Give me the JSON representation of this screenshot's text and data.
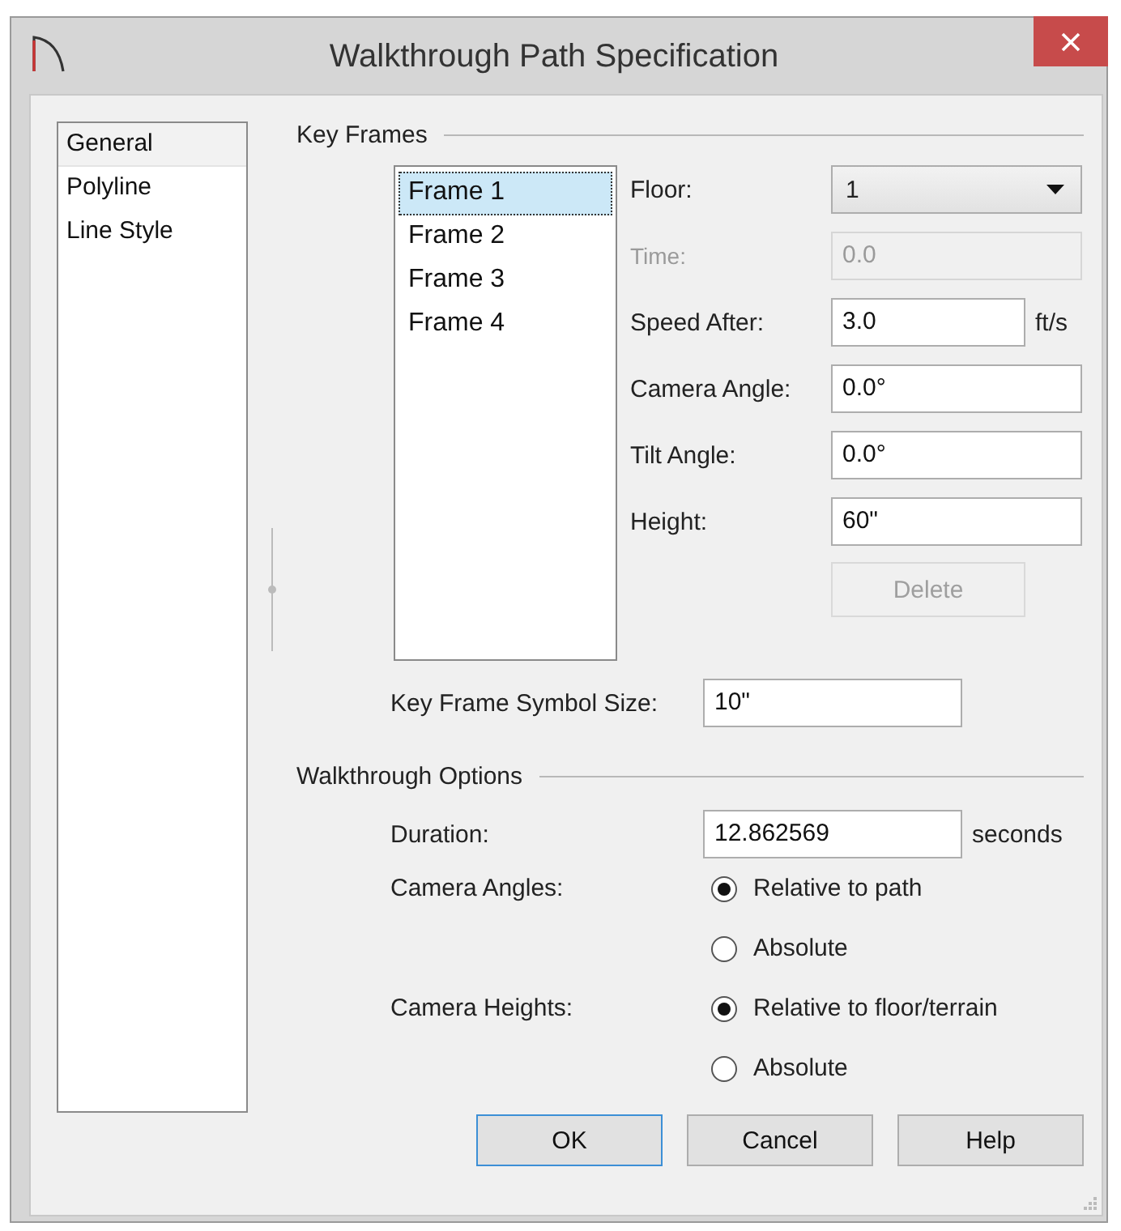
{
  "window": {
    "title": "Walkthrough Path Specification"
  },
  "sidebar": {
    "items": [
      {
        "label": "General",
        "selected": true
      },
      {
        "label": "Polyline",
        "selected": false
      },
      {
        "label": "Line Style",
        "selected": false
      }
    ]
  },
  "key_frames": {
    "heading": "Key Frames",
    "frames": [
      {
        "label": "Frame 1",
        "selected": true
      },
      {
        "label": "Frame 2",
        "selected": false
      },
      {
        "label": "Frame 3",
        "selected": false
      },
      {
        "label": "Frame 4",
        "selected": false
      }
    ],
    "fields": [
      {
        "kind": "select",
        "label": "Floor:",
        "value": "1",
        "disabled": false
      },
      {
        "kind": "input",
        "label": "Time:",
        "value": "0.0",
        "disabled": true
      },
      {
        "kind": "input",
        "label": "Speed After:",
        "value": "3.0",
        "unit": "ft/s",
        "disabled": false
      },
      {
        "kind": "input",
        "label": "Camera Angle:",
        "value": "0.0°",
        "disabled": false
      },
      {
        "kind": "input",
        "label": "Tilt Angle:",
        "value": "0.0°",
        "disabled": false
      },
      {
        "kind": "input",
        "label": "Height:",
        "value": "60\"",
        "disabled": false
      }
    ],
    "delete_button": {
      "label": "Delete",
      "disabled": true
    },
    "symbol_size": {
      "label": "Key Frame Symbol Size:",
      "value": "10\""
    }
  },
  "walkthrough_options": {
    "heading": "Walkthrough Options",
    "duration": {
      "label": "Duration:",
      "value": "12.862569",
      "unit": "seconds"
    },
    "radio_groups": [
      {
        "label": "Camera Angles:",
        "options": [
          {
            "label": "Relative to path",
            "selected": true
          },
          {
            "label": "Absolute",
            "selected": false
          }
        ]
      },
      {
        "label": "Camera Heights:",
        "options": [
          {
            "label": "Relative to floor/terrain",
            "selected": true
          },
          {
            "label": "Absolute",
            "selected": false
          }
        ]
      }
    ]
  },
  "buttons": [
    {
      "label": "OK",
      "default": true
    },
    {
      "label": "Cancel",
      "default": false
    },
    {
      "label": "Help",
      "default": false
    }
  ]
}
